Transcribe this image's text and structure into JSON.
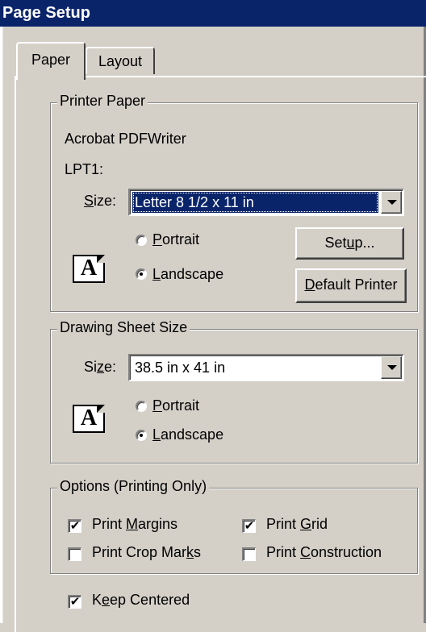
{
  "window": {
    "title": "Page Setup"
  },
  "tabs": [
    {
      "label": "Paper",
      "active": true
    },
    {
      "label": "Layout",
      "active": false
    }
  ],
  "printer_paper": {
    "group_label": "Printer Paper",
    "printer_name": "Acrobat PDFWriter",
    "port": "LPT1:",
    "size_label_pre": "S",
    "size_label_post": "ize:",
    "size_value": "Letter 8 1/2 x 11 in",
    "portrait_ak": "P",
    "portrait_rest": "ortrait",
    "landscape_ak": "L",
    "landscape_rest": "andscape",
    "orientation": "Landscape",
    "setup_pre": "Set",
    "setup_ak": "u",
    "setup_post": "p...",
    "default_ak": "D",
    "default_rest": "efault Printer",
    "icon_glyph": "A"
  },
  "drawing_sheet": {
    "group_label": "Drawing Sheet Size",
    "size_label_pre": "Si",
    "size_label_ak": "z",
    "size_label_post": "e:",
    "size_value": "38.5 in x 41 in",
    "portrait_ak": "P",
    "portrait_rest": "ortrait",
    "landscape_ak": "L",
    "landscape_rest": "andscape",
    "orientation": "Landscape",
    "icon_glyph": "A"
  },
  "options": {
    "group_label": "Options (Printing Only)",
    "print_margins": {
      "pre": "Print ",
      "ak": "M",
      "post": "argins",
      "checked": true
    },
    "print_grid": {
      "pre": "Print ",
      "ak": "G",
      "post": "rid",
      "checked": true
    },
    "print_crop_marks": {
      "pre": "Print Crop Mar",
      "ak": "k",
      "post": "s",
      "checked": false
    },
    "print_construction": {
      "pre": "Print ",
      "ak": "C",
      "post": "onstruction",
      "checked": false
    }
  },
  "keep_centered": {
    "pre": "K",
    "ak": "e",
    "post": "ep Centered",
    "checked": true
  },
  "check_glyph": "✔"
}
